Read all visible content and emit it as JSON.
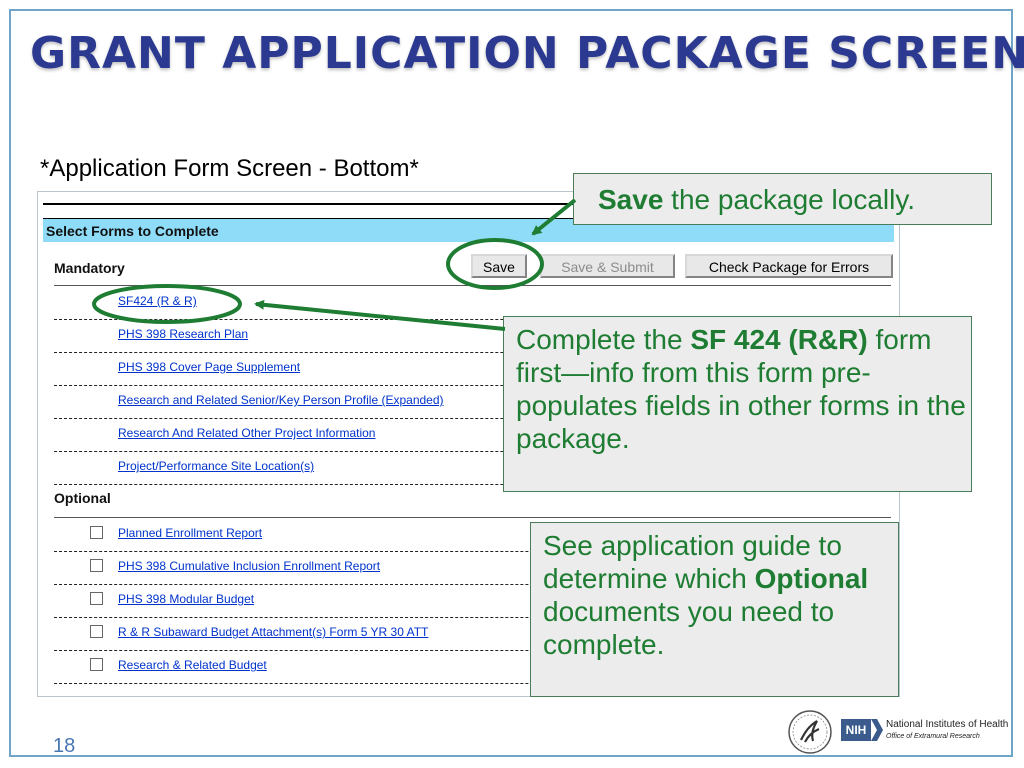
{
  "slide": {
    "title": "GRANT APPLICATION PACKAGE SCREEN",
    "subtitle": "*Application Form Screen - Bottom*",
    "page_number": "18"
  },
  "form_screen": {
    "section_header": "Select Forms to Complete",
    "mandatory_label": "Mandatory",
    "optional_label": "Optional",
    "buttons": {
      "save": "Save",
      "save_submit": "Save & Submit",
      "check": "Check Package for Errors"
    },
    "mandatory_forms": [
      "SF424 (R & R)",
      "PHS 398 Research Plan",
      "PHS 398 Cover Page Supplement",
      "Research and Related Senior/Key Person Profile (Expanded)",
      "Research And Related Other Project Information",
      "Project/Performance Site Location(s)"
    ],
    "optional_forms": [
      "Planned Enrollment Report",
      "PHS 398 Cumulative Inclusion Enrollment Report",
      "PHS 398 Modular Budget",
      "R & R Subaward Budget Attachment(s) Form 5 YR 30 ATT",
      "Research & Related Budget"
    ]
  },
  "callouts": {
    "save": {
      "bold": "Save",
      "rest": " the package locally."
    },
    "sf424": {
      "before": "Complete the ",
      "bold": "SF 424 (R&R)",
      "after": " form first—info from this form pre-populates fields in other forms in the package."
    },
    "optional": {
      "before": "See application guide to determine which ",
      "bold": "Optional",
      "after": " documents you need to complete."
    }
  },
  "footer": {
    "nih_abbrev": "NIH",
    "nih_name": "National Institutes of Health",
    "nih_office": "Office of Extramural Research"
  },
  "colors": {
    "title": "#2b3990",
    "callout_text": "#1e7d32",
    "highlight_ring": "#1e7d32",
    "section_header_bg": "#8fdcf8",
    "link": "#0033cc"
  },
  "icons": {
    "hhs_logo": "hhs-eagle-logo-icon",
    "nih_logo": "nih-logo-icon"
  }
}
